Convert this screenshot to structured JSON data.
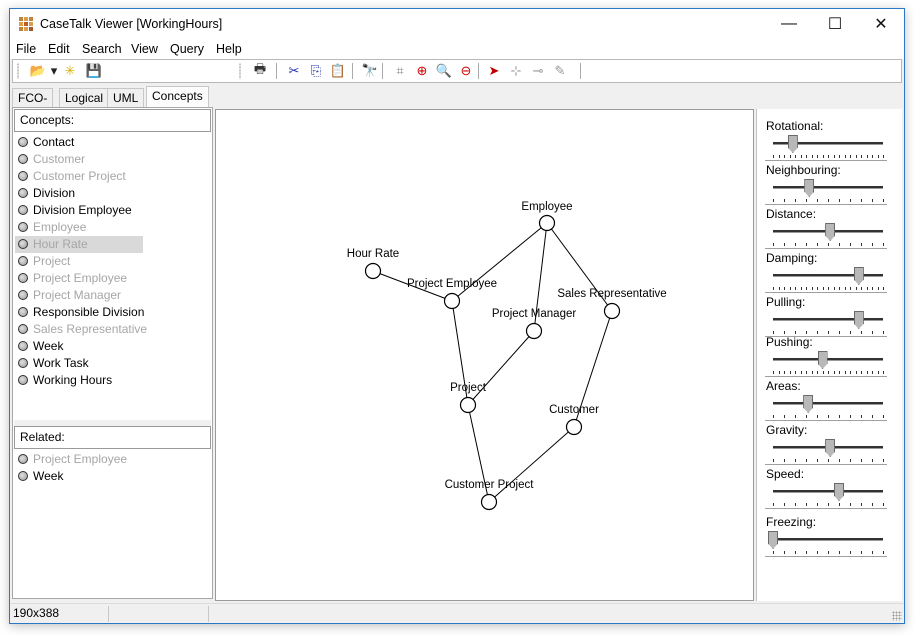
{
  "window": {
    "title": "CaseTalk Viewer [WorkingHours]",
    "controls": {
      "minimize": "—",
      "maximize": "☐",
      "close": "✕"
    }
  },
  "menu": [
    "File",
    "Edit",
    "Search",
    "View",
    "Query",
    "Help"
  ],
  "toolbar": {
    "groups": [
      [
        {
          "name": "open-icon",
          "glyph": "📂"
        },
        {
          "name": "open-dropdown-icon",
          "glyph": "▾"
        },
        {
          "name": "new-icon",
          "glyph": "✳"
        },
        {
          "name": "save-icon",
          "glyph": "💾"
        }
      ],
      [
        {
          "name": "print-icon",
          "glyph": "🖶"
        }
      ],
      [
        {
          "name": "cut-icon",
          "glyph": "✂"
        },
        {
          "name": "copy-icon",
          "glyph": "⎘"
        },
        {
          "name": "paste-icon",
          "glyph": "📋"
        }
      ],
      [
        {
          "name": "find-icon",
          "glyph": "🔭"
        }
      ],
      [
        {
          "name": "fit-icon",
          "glyph": "⌗"
        },
        {
          "name": "zoom-in-icon",
          "glyph": "⊕"
        },
        {
          "name": "zoom-icon",
          "glyph": "🔍"
        },
        {
          "name": "zoom-out-icon",
          "glyph": "⊖"
        }
      ],
      [
        {
          "name": "select-pointer-icon",
          "glyph": "➤"
        },
        {
          "name": "add-node-icon",
          "glyph": "⊹"
        },
        {
          "name": "remove-node-icon",
          "glyph": "⊸"
        },
        {
          "name": "freeze-icon",
          "glyph": "✎"
        }
      ]
    ]
  },
  "tabs": [
    {
      "label": "FCO-IM",
      "active": false
    },
    {
      "label": "Logical",
      "active": false
    },
    {
      "label": "UML",
      "active": false
    },
    {
      "label": "Concepts",
      "active": true
    }
  ],
  "concepts": {
    "header": "Concepts:",
    "items": [
      {
        "label": "Contact",
        "state": "normal"
      },
      {
        "label": "Customer",
        "state": "disabled"
      },
      {
        "label": "Customer Project",
        "state": "disabled"
      },
      {
        "label": "Division",
        "state": "normal"
      },
      {
        "label": "Division Employee",
        "state": "normal"
      },
      {
        "label": "Employee",
        "state": "disabled"
      },
      {
        "label": "Hour Rate",
        "state": "selected"
      },
      {
        "label": "Project",
        "state": "disabled"
      },
      {
        "label": "Project Employee",
        "state": "disabled"
      },
      {
        "label": "Project Manager",
        "state": "disabled"
      },
      {
        "label": "Responsible Division",
        "state": "normal"
      },
      {
        "label": "Sales Representative",
        "state": "disabled"
      },
      {
        "label": "Week",
        "state": "normal"
      },
      {
        "label": "Work Task",
        "state": "normal"
      },
      {
        "label": "Working Hours",
        "state": "normal"
      }
    ]
  },
  "related": {
    "header": "Related:",
    "items": [
      {
        "label": "Project Employee",
        "state": "disabled"
      },
      {
        "label": "Week",
        "state": "normal"
      }
    ]
  },
  "graph": {
    "nodes": [
      {
        "id": "employee",
        "label": "Employee"
      },
      {
        "id": "hour-rate",
        "label": "Hour Rate"
      },
      {
        "id": "project-employee",
        "label": "Project Employee"
      },
      {
        "id": "sales-representative",
        "label": "Sales Representative"
      },
      {
        "id": "project-manager",
        "label": "Project Manager"
      },
      {
        "id": "project",
        "label": "Project"
      },
      {
        "id": "customer",
        "label": "Customer"
      },
      {
        "id": "customer-project",
        "label": "Customer Project"
      }
    ],
    "edges": [
      [
        "employee",
        "project-employee"
      ],
      [
        "employee",
        "project-manager"
      ],
      [
        "employee",
        "sales-representative"
      ],
      [
        "hour-rate",
        "project-employee"
      ],
      [
        "project-employee",
        "project"
      ],
      [
        "project-manager",
        "project"
      ],
      [
        "sales-representative",
        "customer"
      ],
      [
        "project",
        "customer-project"
      ],
      [
        "customer",
        "customer-project"
      ]
    ]
  },
  "sliders": [
    {
      "label": "Rotational:",
      "value": 0.18,
      "ticks": 21
    },
    {
      "label": "Neighbouring:",
      "value": 0.33,
      "ticks": 11
    },
    {
      "label": "Distance:",
      "value": 0.52,
      "ticks": 11
    },
    {
      "label": "Damping:",
      "value": 0.78,
      "ticks": 21
    },
    {
      "label": "Pulling:",
      "value": 0.78,
      "ticks": 11
    },
    {
      "label": "Pushing:",
      "value": 0.45,
      "ticks": 21
    },
    {
      "label": "Areas:",
      "value": 0.32,
      "ticks": 11
    },
    {
      "label": "Gravity:",
      "value": 0.52,
      "ticks": 11
    },
    {
      "label": "Speed:",
      "value": 0.6,
      "ticks": 11
    },
    {
      "label": "Freezing:",
      "value": 0.0,
      "ticks": 11
    }
  ],
  "status": {
    "size": "190x388",
    "cell2": "",
    "cell3": ""
  },
  "colors": {
    "accent": "#2b78c6",
    "disabled_text": "#a6a6a6",
    "selected_bg": "#d9d9d9"
  }
}
